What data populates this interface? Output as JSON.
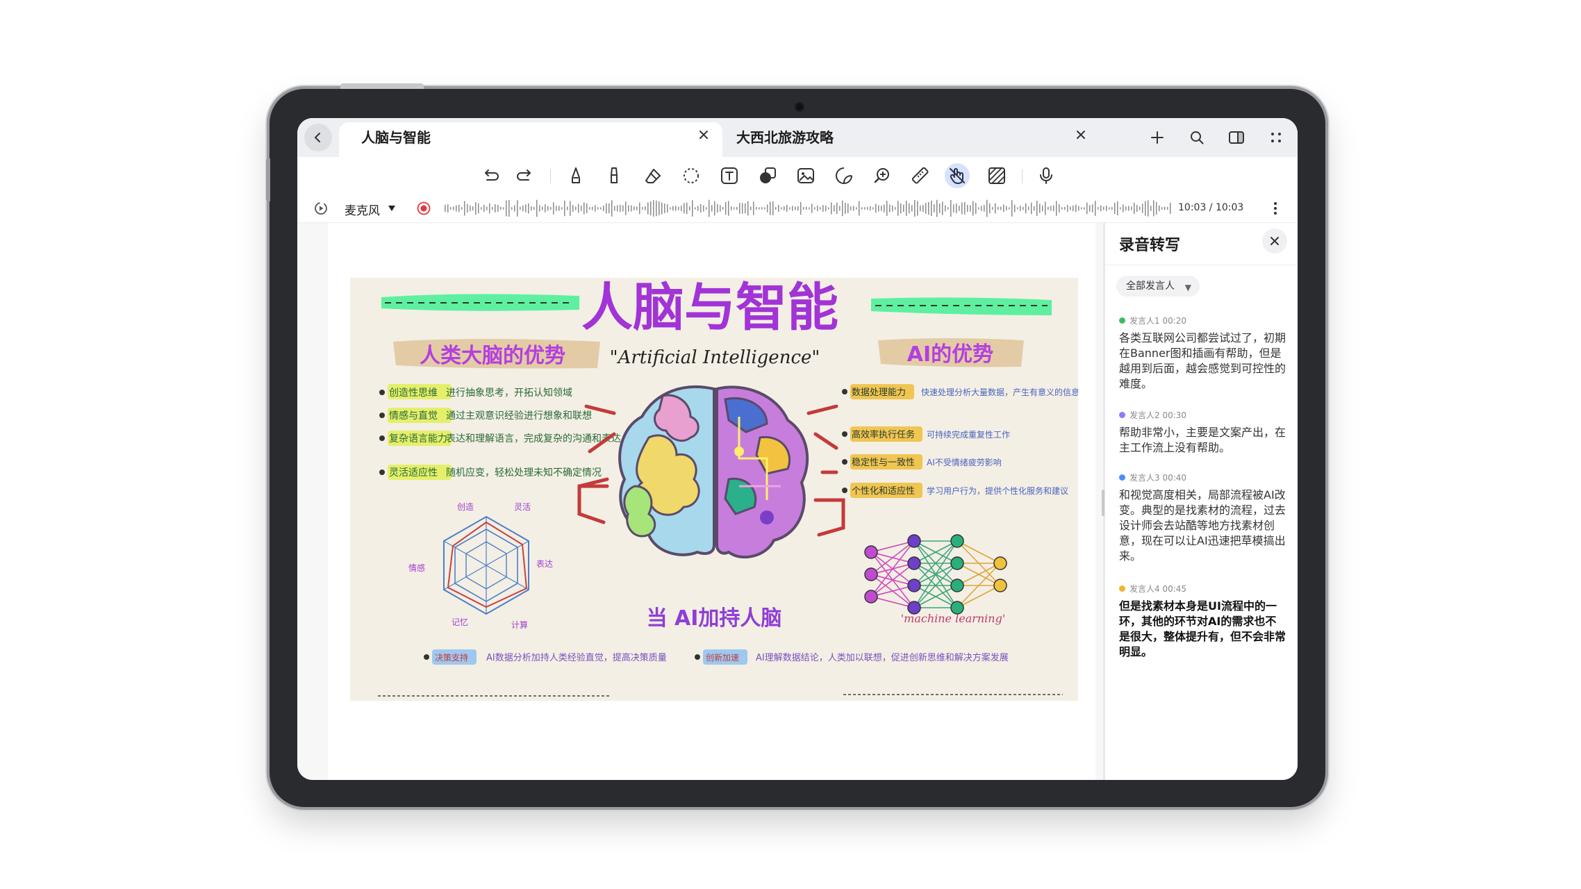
{
  "tabs": [
    {
      "title": "人脑与智能",
      "active": true
    },
    {
      "title": "大西北旅游攻略",
      "active": false
    }
  ],
  "toolbar": {
    "tools": [
      "undo-icon",
      "redo-icon",
      "pen-icon",
      "marker-icon",
      "eraser-icon",
      "lasso-icon",
      "text-icon",
      "shape-icon",
      "image-icon",
      "sticker-icon",
      "zoom-icon",
      "ruler-icon",
      "touch-draw-icon",
      "background-icon",
      "record-icon"
    ]
  },
  "recording": {
    "source": "麦克风",
    "time": "10:03 / 10:03"
  },
  "note": {
    "title": "人脑与智能",
    "left_header": "人类大脑的优势",
    "center_subtitle": "\"Artificial Intelligence\"",
    "right_header": "AI的优势",
    "left_items": [
      {
        "tag": "创造性思维",
        "text": "进行抽象思考，开拓认知领域"
      },
      {
        "tag": "情感与直觉",
        "text": "通过主观意识经验进行想象和联想"
      },
      {
        "tag": "复杂语言能力",
        "text": "表达和理解语言，完成复杂的沟通和表达"
      },
      {
        "tag": "灵活适应性",
        "text": "随机应变，轻松处理未知不确定情况"
      }
    ],
    "right_items": [
      {
        "tag": "数据处理能力",
        "text": "快速处理分析大量数据，产生有意义的信息"
      },
      {
        "tag": "高效率执行任务",
        "text": "可持续完成重复性工作"
      },
      {
        "tag": "稳定性与一致性",
        "text": "AI不受情绪疲劳影响"
      },
      {
        "tag": "个性化和适应性",
        "text": "学习用户行为，提供个性化服务和建议"
      }
    ],
    "radar_labels": [
      "创造",
      "灵活",
      "表达",
      "计算",
      "记忆",
      "情感"
    ],
    "bottom_title": "当 AI加持人脑",
    "bottom_items": [
      {
        "tag": "决策支持",
        "text": "AI数据分析加持人类经验直觉，提高决策质量"
      },
      {
        "tag": "创新加速",
        "text": "AI理解数据结论，人类加以联想，促进创新思维和解决方案发展"
      }
    ],
    "ml_label": "'machine learning'"
  },
  "transcript": {
    "title": "录音转写",
    "filter": "全部发言人",
    "entries": [
      {
        "speaker": "发言人1 00:20",
        "color": "#3dbb61",
        "text": "各类互联网公司都尝试过了，初期在Banner图和插画有帮助，但是越用到后面，越会感觉到可控性的难度。",
        "bold": false
      },
      {
        "speaker": "发言人2 00:30",
        "color": "#8e7cf0",
        "text": "帮助非常小，主要是文案产出，在主工作流上没有帮助。",
        "bold": false
      },
      {
        "speaker": "发言人3 00:40",
        "color": "#4b8ff7",
        "text": "和视觉高度相关，局部流程被AI改变。典型的是找素材的流程，过去设计师会去站酷等地方找素材创意，现在可以让AI迅速把草模搞出来。",
        "bold": false
      },
      {
        "speaker": "发言人4 00:45",
        "color": "#f2b233",
        "text": "但是找素材本身是UI流程中的一环，其他的环节对AI的需求也不是很大，整体提升有，但不会非常明显。",
        "bold": true
      }
    ]
  }
}
